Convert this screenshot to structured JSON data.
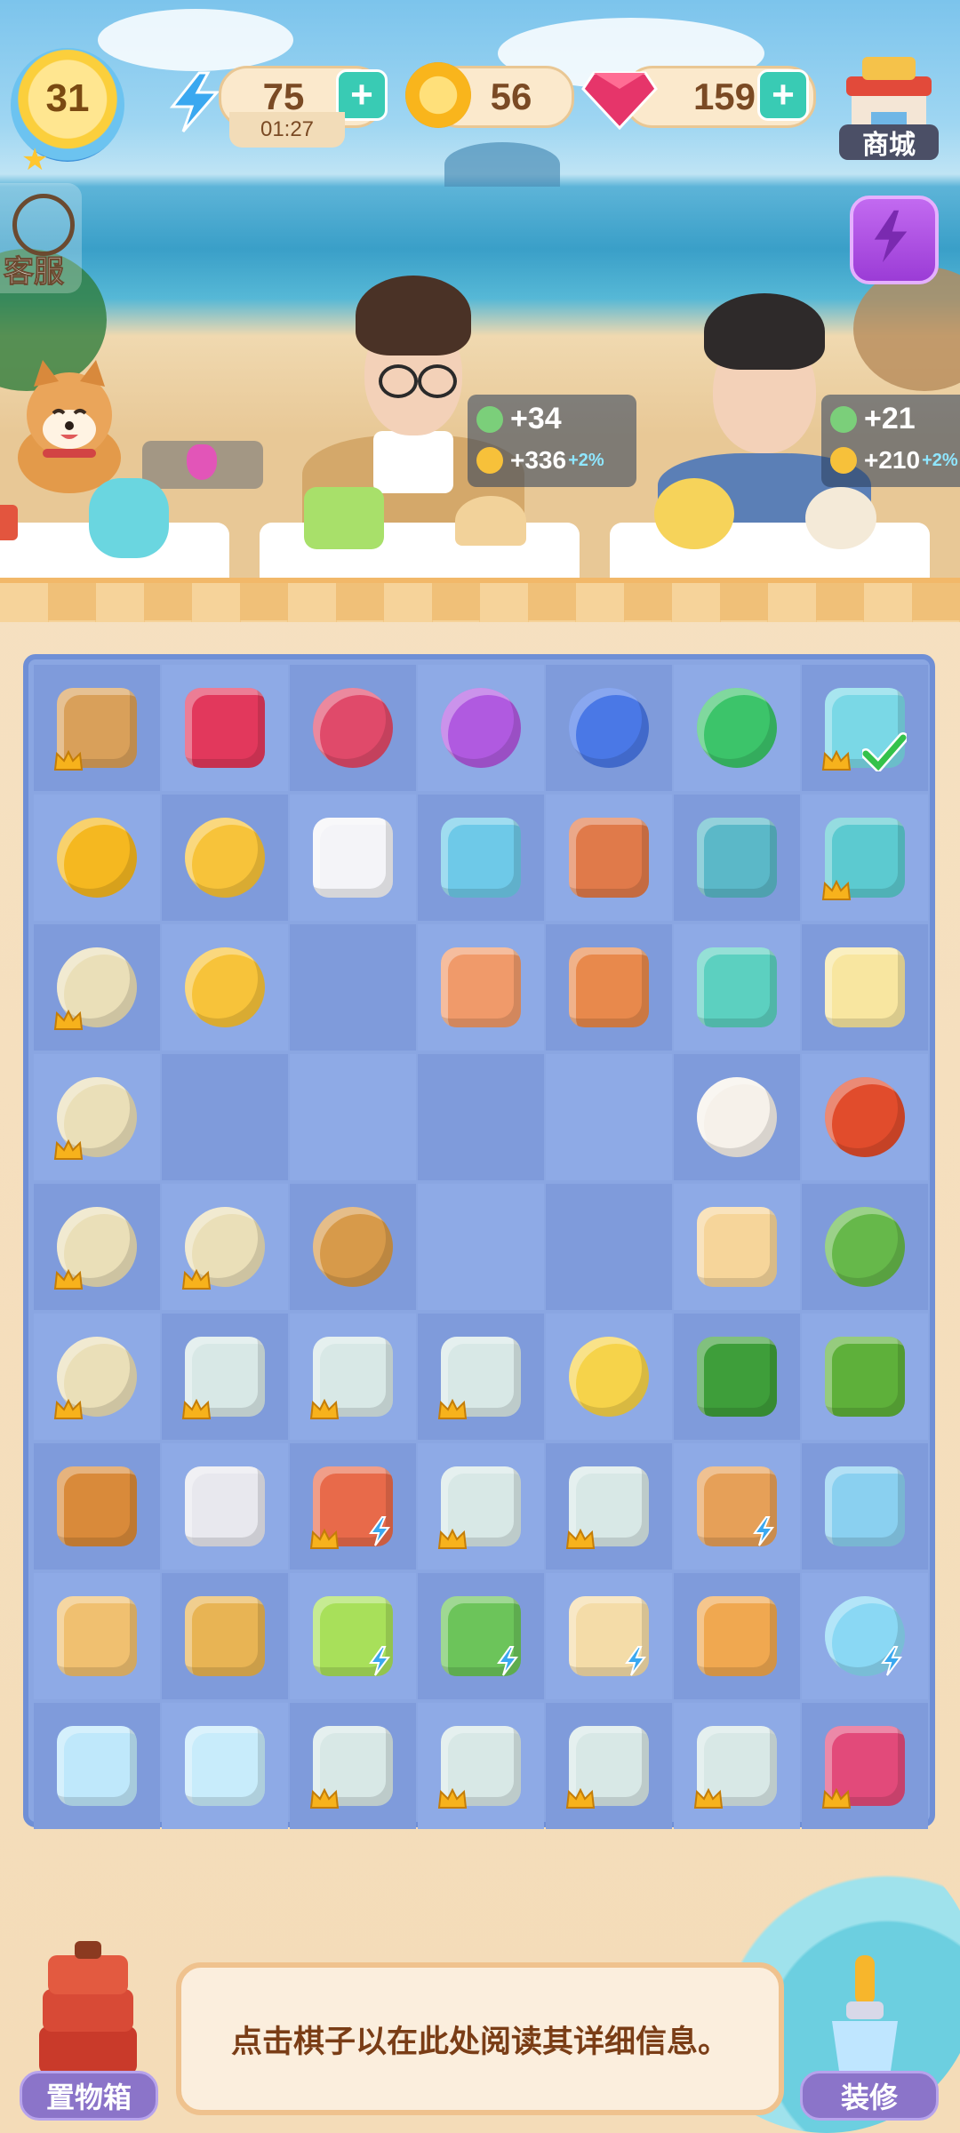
{
  "hud": {
    "level": "31",
    "energy": "75",
    "energy_timer": "01:27",
    "coins": "56",
    "gems": "159",
    "shop_label": "商城",
    "service_label": "客服"
  },
  "customers": [
    {
      "energy_reward": "+34",
      "coin_reward": "+336",
      "bonus": "+2%"
    },
    {
      "energy_reward": "+21",
      "coin_reward": "+210",
      "bonus": "+2%"
    }
  ],
  "board": {
    "rows": 9,
    "cols": 7,
    "cells": [
      [
        "bamboo-basket-dessert",
        "ruby-gems",
        "red-energy-orb",
        "purple-energy-orb",
        "blue-energy-orb",
        "green-energy-orb",
        "candy-jar"
      ],
      [
        "coin-pile-large",
        "coin-stack",
        "tea-cup",
        "dog-food-bag",
        "pickle-jar",
        "cooking-pot-set",
        "dog-house"
      ],
      [
        "corn-soup-bowl",
        "coin-stack-small",
        "",
        "",
        "dog-bone-heart",
        "dog-biscuit",
        "baby-bottle-cheese",
        "butter-cubes"
      ],
      [
        "corn-soup-bowl",
        "",
        "",
        "",
        "",
        "teapot-lid",
        "red-apple"
      ],
      [
        "corn-soup-bowl",
        "corn-soup-bowl",
        "flower-steamer",
        "",
        "",
        "flower-cake",
        "cabbage"
      ],
      [
        "corn-soup-bowl",
        "sake-set",
        "sake-set",
        "sake-set",
        "lemon-cake",
        "broccoli",
        "okra"
      ],
      [
        "roast-chicken",
        "bento-box",
        "fish-platter",
        "sake-set",
        "sake-set",
        "cherry-basket",
        "mini-fridge"
      ],
      [
        "spatula-small",
        "spatula",
        "juicer",
        "bok-choy-basket",
        "custard-pot",
        "seafood-paella",
        "fish-bowl"
      ],
      [
        "ice-cubes",
        "ice-cube",
        "sake-set",
        "sake-set",
        "sake-set",
        "sake-set",
        "dragon-fruit"
      ]
    ]
  },
  "info_text": "点击棋子以在此处阅读其详细信息。",
  "bottom": {
    "storage_label": "置物箱",
    "decor_label": "装修"
  }
}
